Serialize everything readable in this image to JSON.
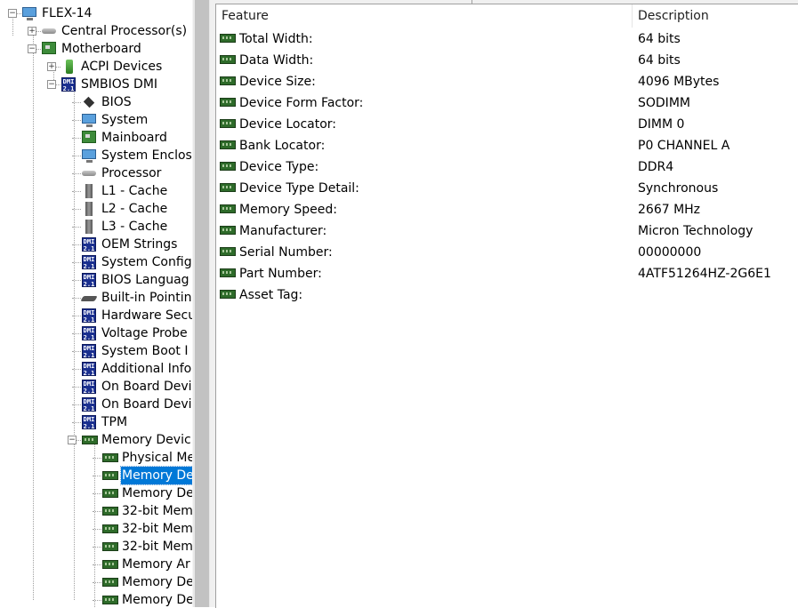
{
  "tree": {
    "items": [
      {
        "label": "FLEX-14",
        "icon": "monitor-icon",
        "level": 0,
        "expander": "minus"
      },
      {
        "label": "Central Processor(s)",
        "icon": "cpu-icon",
        "level": 1,
        "expander": "plus"
      },
      {
        "label": "Motherboard",
        "icon": "motherboard-icon",
        "level": 1,
        "expander": "minus"
      },
      {
        "label": "ACPI Devices",
        "icon": "acpi-icon",
        "level": 2,
        "expander": "plus"
      },
      {
        "label": "SMBIOS DMI",
        "icon": "dmi-icon",
        "level": 2,
        "expander": "minus"
      },
      {
        "label": "BIOS",
        "icon": "chip-icon",
        "level": 3
      },
      {
        "label": "System",
        "icon": "monitor-icon",
        "level": 3
      },
      {
        "label": "Mainboard",
        "icon": "motherboard-icon",
        "level": 3
      },
      {
        "label": "System Enclos",
        "icon": "monitor-icon",
        "level": 3
      },
      {
        "label": "Processor",
        "icon": "cpu-icon",
        "level": 3
      },
      {
        "label": "L1 - Cache",
        "icon": "cache-icon",
        "level": 3
      },
      {
        "label": "L2 - Cache",
        "icon": "cache-icon",
        "level": 3
      },
      {
        "label": "L3 - Cache",
        "icon": "cache-icon",
        "level": 3
      },
      {
        "label": "OEM Strings",
        "icon": "dmi-icon",
        "level": 3
      },
      {
        "label": "System Config",
        "icon": "dmi-icon",
        "level": 3
      },
      {
        "label": "BIOS Languag",
        "icon": "dmi-icon",
        "level": 3
      },
      {
        "label": "Built-in Pointing",
        "icon": "pointing-device-icon",
        "level": 3
      },
      {
        "label": "Hardware Secu",
        "icon": "dmi-icon",
        "level": 3
      },
      {
        "label": "Voltage Probe",
        "icon": "dmi-icon",
        "level": 3
      },
      {
        "label": "System Boot I",
        "icon": "dmi-icon",
        "level": 3
      },
      {
        "label": "Additional Infor",
        "icon": "dmi-icon",
        "level": 3
      },
      {
        "label": "On Board Devi",
        "icon": "dmi-icon",
        "level": 3
      },
      {
        "label": "On Board Devi",
        "icon": "dmi-icon",
        "level": 3
      },
      {
        "label": "TPM",
        "icon": "dmi-icon",
        "level": 3
      },
      {
        "label": "Memory Devic",
        "icon": "memory-icon",
        "level": 3,
        "expander": "minus"
      },
      {
        "label": "Physical Me",
        "icon": "memory-icon",
        "level": 4
      },
      {
        "label": "Memory De",
        "icon": "memory-icon",
        "level": 4,
        "selected": true
      },
      {
        "label": "Memory De",
        "icon": "memory-icon",
        "level": 4
      },
      {
        "label": "32-bit Mem",
        "icon": "memory-icon",
        "level": 4
      },
      {
        "label": "32-bit Mem",
        "icon": "memory-icon",
        "level": 4
      },
      {
        "label": "32-bit Mem",
        "icon": "memory-icon",
        "level": 4
      },
      {
        "label": "Memory Ar",
        "icon": "memory-icon",
        "level": 4
      },
      {
        "label": "Memory De",
        "icon": "memory-icon",
        "level": 4
      },
      {
        "label": "Memory De",
        "icon": "memory-icon",
        "level": 4
      }
    ]
  },
  "details": {
    "headers": {
      "feature": "Feature",
      "description": "Description"
    },
    "rows": [
      {
        "feature": "Total Width:",
        "description": "64 bits"
      },
      {
        "feature": "Data Width:",
        "description": "64 bits"
      },
      {
        "feature": "Device Size:",
        "description": "4096 MBytes"
      },
      {
        "feature": "Device Form Factor:",
        "description": "SODIMM"
      },
      {
        "feature": "Device Locator:",
        "description": "DIMM 0"
      },
      {
        "feature": "Bank Locator:",
        "description": "P0 CHANNEL A"
      },
      {
        "feature": "Device Type:",
        "description": "DDR4"
      },
      {
        "feature": "Device Type Detail:",
        "description": "Synchronous"
      },
      {
        "feature": "Memory Speed:",
        "description": "2667 MHz"
      },
      {
        "feature": "Manufacturer:",
        "description": "Micron Technology"
      },
      {
        "feature": "Serial Number:",
        "description": "00000000"
      },
      {
        "feature": "Part Number:",
        "description": "4ATF51264HZ-2G6E1"
      },
      {
        "feature": "Asset Tag:",
        "description": ""
      }
    ]
  },
  "dmi_icon_text": {
    "top": "DMI",
    "bottom": "2.1"
  },
  "colors": {
    "selection": "#0078d7",
    "dmi_badge": "#1a2f8f",
    "memory_module": "#2e6b2a"
  }
}
